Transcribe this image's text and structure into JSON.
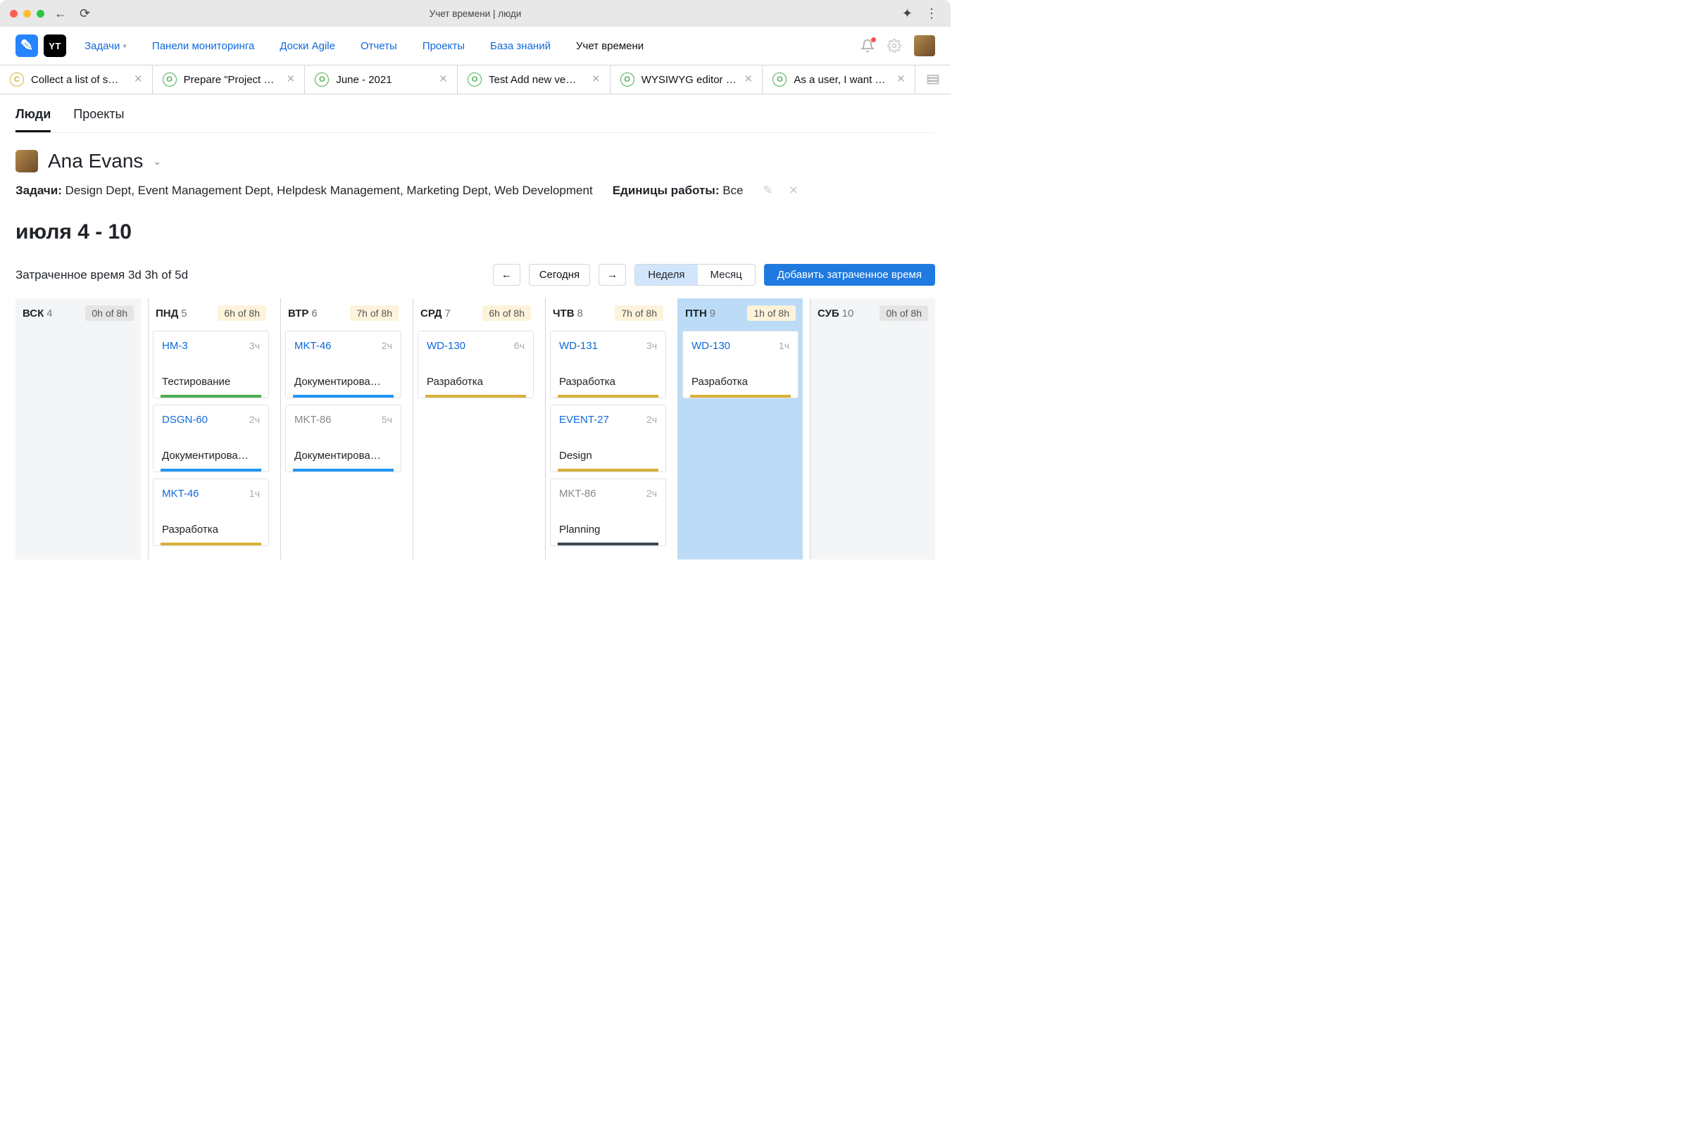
{
  "chrome": {
    "title": "Учет времени | люди"
  },
  "nav": {
    "tasks": "Задачи",
    "dashboards": "Панели мониторинга",
    "agile": "Доски Agile",
    "reports": "Отчеты",
    "projects": "Проекты",
    "kb": "База знаний",
    "time": "Учет времени"
  },
  "issueTabs": [
    {
      "badge": "C",
      "color": "#d8b13b",
      "label": "Collect a list of s…"
    },
    {
      "badge": "O",
      "color": "#4caf50",
      "label": "Prepare \"Project …"
    },
    {
      "badge": "O",
      "color": "#4caf50",
      "label": "June - 2021"
    },
    {
      "badge": "O",
      "color": "#4caf50",
      "label": "Test Add new ve…"
    },
    {
      "badge": "O",
      "color": "#4caf50",
      "label": "WYSIWYG editor …"
    },
    {
      "badge": "O",
      "color": "#4caf50",
      "label": "As a user, I want …"
    }
  ],
  "subtabs": {
    "people": "Люди",
    "projects": "Проекты"
  },
  "user": {
    "name": "Ana Evans"
  },
  "filters": {
    "tasksLabel": "Задачи:",
    "tasksValue": "Design Dept, Event Management Dept, Helpdesk Management, Marketing Dept, Web Development",
    "unitsLabel": "Единицы работы:",
    "unitsValue": "Все"
  },
  "dateRange": "июля 4 - 10",
  "spent": {
    "label": "Затраченное время",
    "value": "3d 3h of 5d"
  },
  "controls": {
    "today": "Сегодня",
    "week": "Неделя",
    "month": "Месяц",
    "add": "Добавить затраченное время"
  },
  "days": [
    {
      "abbr": "ВСК",
      "num": "4",
      "hours": "0h of 8h",
      "weekend": true,
      "cards": []
    },
    {
      "abbr": "ПНД",
      "num": "5",
      "hours": "6h of 8h",
      "cards": [
        {
          "id": "HM-3",
          "time": "3ч",
          "title": "Тестирование",
          "bar": "green"
        },
        {
          "id": "DSGN-60",
          "time": "2ч",
          "title": "Документирова…",
          "bar": "blue"
        },
        {
          "id": "MKT-46",
          "time": "1ч",
          "title": "Разработка",
          "bar": "gold"
        }
      ]
    },
    {
      "abbr": "ВТР",
      "num": "6",
      "hours": "7h of 8h",
      "cards": [
        {
          "id": "MKT-46",
          "time": "2ч",
          "title": "Документирова…",
          "bar": "blue"
        },
        {
          "id": "MKT-86",
          "time": "5ч",
          "title": "Документирова…",
          "bar": "blue",
          "muted": true
        }
      ]
    },
    {
      "abbr": "СРД",
      "num": "7",
      "hours": "6h of 8h",
      "cards": [
        {
          "id": "WD-130",
          "time": "6ч",
          "title": "Разработка",
          "bar": "gold"
        }
      ]
    },
    {
      "abbr": "ЧТВ",
      "num": "8",
      "hours": "7h of 8h",
      "cards": [
        {
          "id": "WD-131",
          "time": "3ч",
          "title": "Разработка",
          "bar": "gold"
        },
        {
          "id": "EVENT-27",
          "time": "2ч",
          "title": "Design",
          "bar": "gold"
        },
        {
          "id": "MKT-86",
          "time": "2ч",
          "title": "Planning",
          "bar": "dark",
          "muted": true
        }
      ]
    },
    {
      "abbr": "ПТН",
      "num": "9",
      "hours": "1h of 8h",
      "today": true,
      "cards": [
        {
          "id": "WD-130",
          "time": "1ч",
          "title": "Разработка",
          "bar": "gold"
        }
      ]
    },
    {
      "abbr": "СУБ",
      "num": "10",
      "hours": "0h of 8h",
      "weekend": true,
      "cards": []
    }
  ]
}
